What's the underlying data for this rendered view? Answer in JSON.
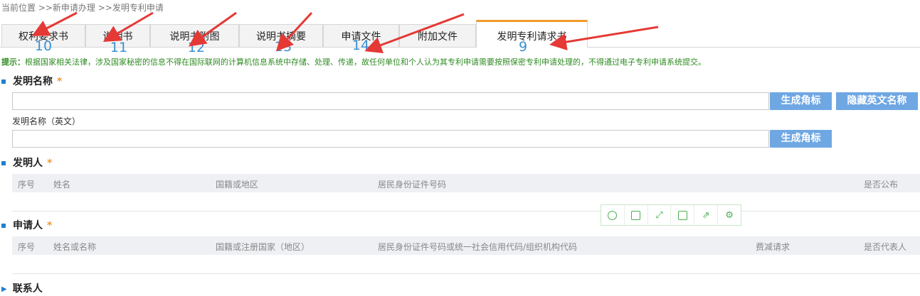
{
  "breadcrumb": {
    "text": "当前位置 >>新申请办理 >>发明专利申请"
  },
  "tabs": [
    {
      "label": "权利要求书",
      "num": "10"
    },
    {
      "label": "说明书",
      "num": "11"
    },
    {
      "label": "说明书附图",
      "num": "12"
    },
    {
      "label": "说明书摘要",
      "num": "13"
    },
    {
      "label": "申请文件",
      "num": "14"
    },
    {
      "label": "附加文件",
      "num": ""
    },
    {
      "label": "发明专利请求书",
      "num": "9"
    }
  ],
  "tip": {
    "prefix": "提示：",
    "text": "根据国家相关法律，涉及国家秘密的信息不得在国际联网的计算机信息系统中存储、处理、传递，故任何单位和个人认为其专利申请需要按照保密专利申请处理的，不得通过电子专利申请系统提交。"
  },
  "invention_name": {
    "title": "发明名称",
    "star": "*",
    "generate_label": "生成角标",
    "hide_english_label": "隐藏英文名称",
    "value": "",
    "english_label": "发明名称（英文）",
    "english_value": "",
    "english_generate_label": "生成角标"
  },
  "inventor": {
    "title": "发明人",
    "star": "*",
    "columns": [
      "序号",
      "姓名",
      "国籍或地区",
      "居民身份证件号码",
      "是否公布"
    ]
  },
  "applicant": {
    "title": "申请人",
    "star": "*",
    "columns": [
      "序号",
      "姓名或名称",
      "国籍或注册国家（地区）",
      "居民身份证件号码或统一社会信用代码/组织机构代码",
      "费减请求",
      "是否代表人"
    ]
  },
  "contact": {
    "title": "联系人"
  },
  "toolbar": {
    "icons": [
      "copyright-icon",
      "tablet-icon",
      "expand-icon",
      "save-icon",
      "share-icon",
      "settings-icon"
    ]
  },
  "colors": {
    "accent_blue": "#1f7fd1",
    "button_blue": "#6fa7e3",
    "tab_active_border": "#f39a2b",
    "tip_green": "#2e8b22",
    "annotation_red": "#e53935",
    "number_blue": "#3a8fd1"
  }
}
